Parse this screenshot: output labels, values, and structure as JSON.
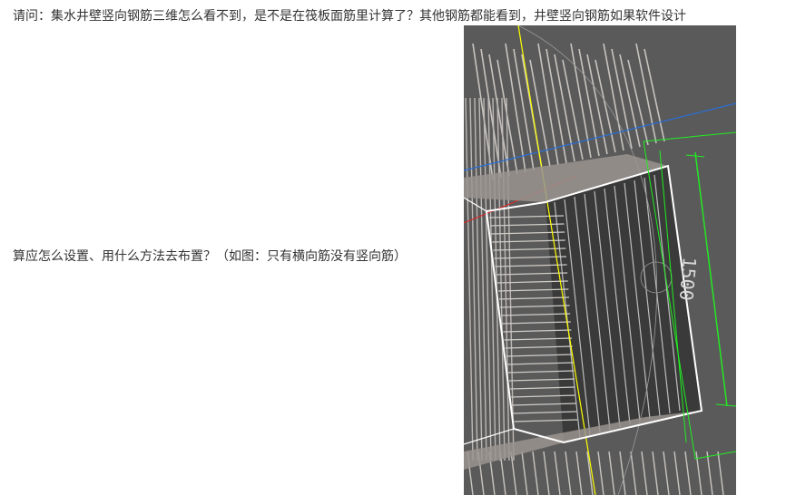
{
  "post": {
    "line1": "请问：集水井壁竖向钢筋三维怎么看不到，是不是在筏板面筋里计算了？其他钢筋都能看到，井壁竖向钢筋如果软件设计",
    "line2": "算应怎么设置、用什么方法去布置？（如图：只有横向筋没有竖向筋）"
  },
  "screenshot": {
    "dimension_label": "1500",
    "colors": {
      "background": "#5a5a5a",
      "rebar": "#c8c4c0",
      "outline": "#ffffff",
      "axis_yellow": "#ffff00",
      "axis_blue": "#2a6fd6",
      "axis_red": "#d62a2a",
      "dimension_green": "#22ee22",
      "pit_floor": "#3a3a3a"
    }
  }
}
